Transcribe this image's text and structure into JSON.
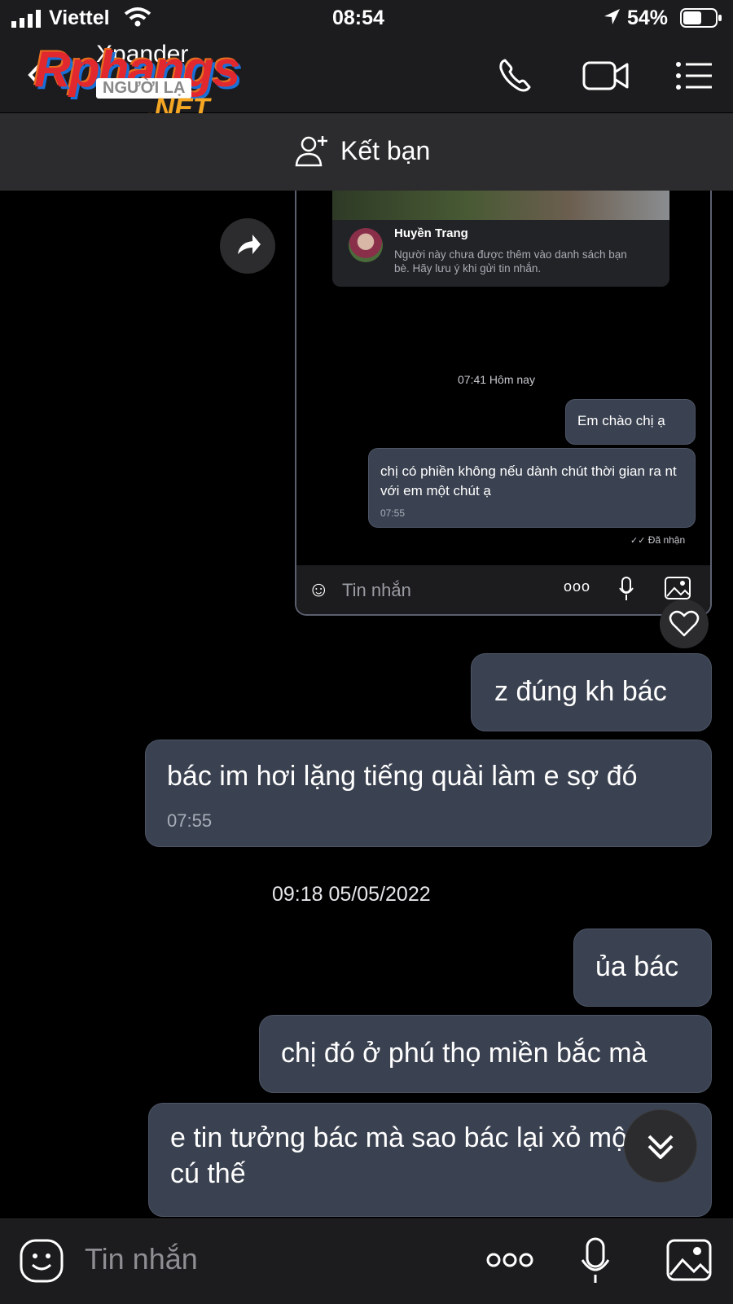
{
  "status": {
    "carrier": "Viettel",
    "time": "08:54",
    "battery": "54%"
  },
  "header": {
    "contact_name": "Xpander",
    "watermark_brand": "Rphangs",
    "watermark_sub": "NGƯỜI LẠ",
    "watermark_domain": ".NET"
  },
  "add_friend": {
    "label": "Kết bạn"
  },
  "embedded": {
    "card_name": "Huyền Trang",
    "card_note": "Người này chưa được thêm vào danh sách bạn bè. Hãy lưu ý khi gửi tin nhắn.",
    "timestamp": "07:41 Hôm nay",
    "msg1": "Em chào chị ạ",
    "msg2": "chị có phiền không nếu dành chút thời gian ra nt với em một chút ạ",
    "msg2_time": "07:55",
    "receipt": "Đã nhận",
    "input_placeholder": "Tin nhắn"
  },
  "messages": {
    "m1": "z đúng kh bác",
    "m2": "bác im hơi lặng tiếng quài làm e sợ đó",
    "m2_time": "07:55",
    "date_sep": "09:18 05/05/2022",
    "m3": "ủa bác",
    "m4": "chị đó ở phú thọ miền bắc mà",
    "m5": " e tin tưởng bác mà sao bác lại xỏ một cú thế"
  },
  "input": {
    "placeholder": "Tin nhắn"
  },
  "colors": {
    "bubble": "#3a4150",
    "bar": "#1c1c1e",
    "accent": "#5b6070"
  }
}
